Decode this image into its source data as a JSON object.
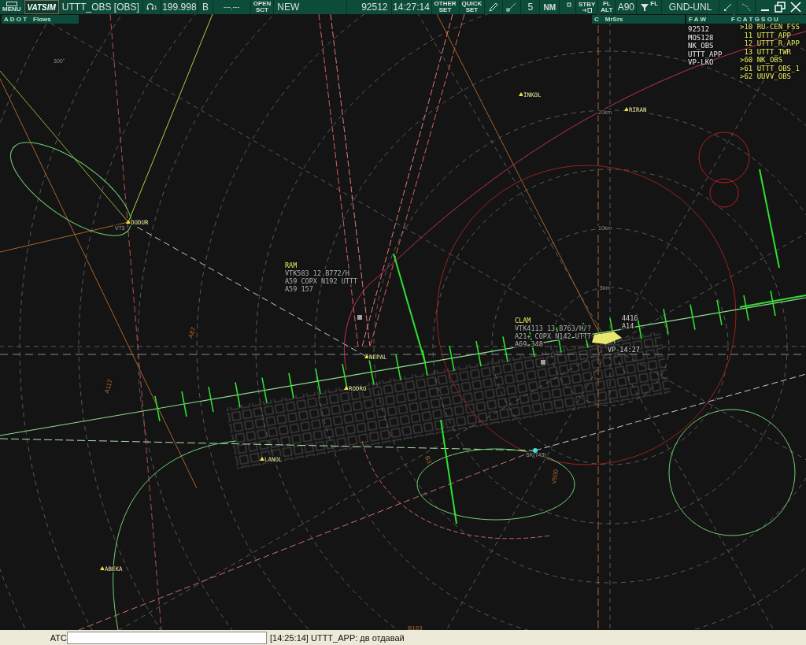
{
  "toolbar": {
    "menu_label": "MENU",
    "logo": "VATSIM",
    "callsign": "UTTT_OBS [OBS]",
    "headset_index": "1",
    "frequency": "199.998",
    "atis_letter": "B",
    "secondary_frequency": "---.---",
    "open_label": "OPEN",
    "sct_label": "SCT",
    "sector_status": "NEW",
    "squawk": "92512",
    "clock": "14:27:14",
    "other_set": [
      "OTHER",
      "SET"
    ],
    "quick_set": [
      "QUICK",
      "SET"
    ],
    "range": "5",
    "range_unit": "NM",
    "stby_label": "STBY",
    "fl_alt": [
      "FL",
      "ALT"
    ],
    "altimeter": "A90",
    "filter_label": "FL",
    "altitude_filter": "GND-UNL"
  },
  "panel_headers": [
    {
      "tabs": "A D O T",
      "title": "Flows"
    },
    {
      "tabs": "C",
      "title": "MrSrs"
    },
    {
      "tabs": "F A W"
    },
    {
      "tabs": "F C A T G S O U"
    }
  ],
  "pilot_list": [
    "92512",
    "MOS128",
    "NK_OBS",
    "UTTT_APP",
    "VP-LKO"
  ],
  "controller_list": [
    {
      "marker": ">",
      "text": "10 RU-CEN_FSS"
    },
    {
      "text": "11 UTTT_APP"
    },
    {
      "text": "12 UTTT_R_APP"
    },
    {
      "text": "13 UTTT_TWR"
    },
    {
      "marker": ">",
      "text": "60 NK_OBS"
    },
    {
      "marker": ">",
      "text": "61 UTTT_OBS_1"
    },
    {
      "marker": ">",
      "text": "62 UUVV_OBS"
    }
  ],
  "map": {
    "range_labels": [
      "300°",
      "20km",
      "10km",
      "5km"
    ],
    "airway_labels": [
      "A117",
      "A87",
      "V500",
      "B163",
      "B3"
    ],
    "waypoints": [
      "INKOL",
      "RIRAN",
      "DODUR",
      "NEPAL",
      "RODRO",
      "LANOL",
      "ABEKA"
    ],
    "fix_labels": [
      "V73",
      "SK(743)"
    ],
    "aircraft": [
      {
        "callsign": "RAM",
        "lines": [
          "VTK583 12 B772/H",
          "A59 COPX N192 UTTT",
          "A59 157"
        ]
      },
      {
        "callsign": "CLAM",
        "lines": [
          "VTK4113 13 B763/H/?",
          "A21+ COPX N142 UTTT",
          "A69 348"
        ]
      }
    ],
    "airport_block": [
      "4416",
      "A14",
      "VP-14:27"
    ]
  },
  "bottom_bar": {
    "label": "ATC",
    "message": "[14:25:14] UTTT_APP: дв отдавай"
  }
}
